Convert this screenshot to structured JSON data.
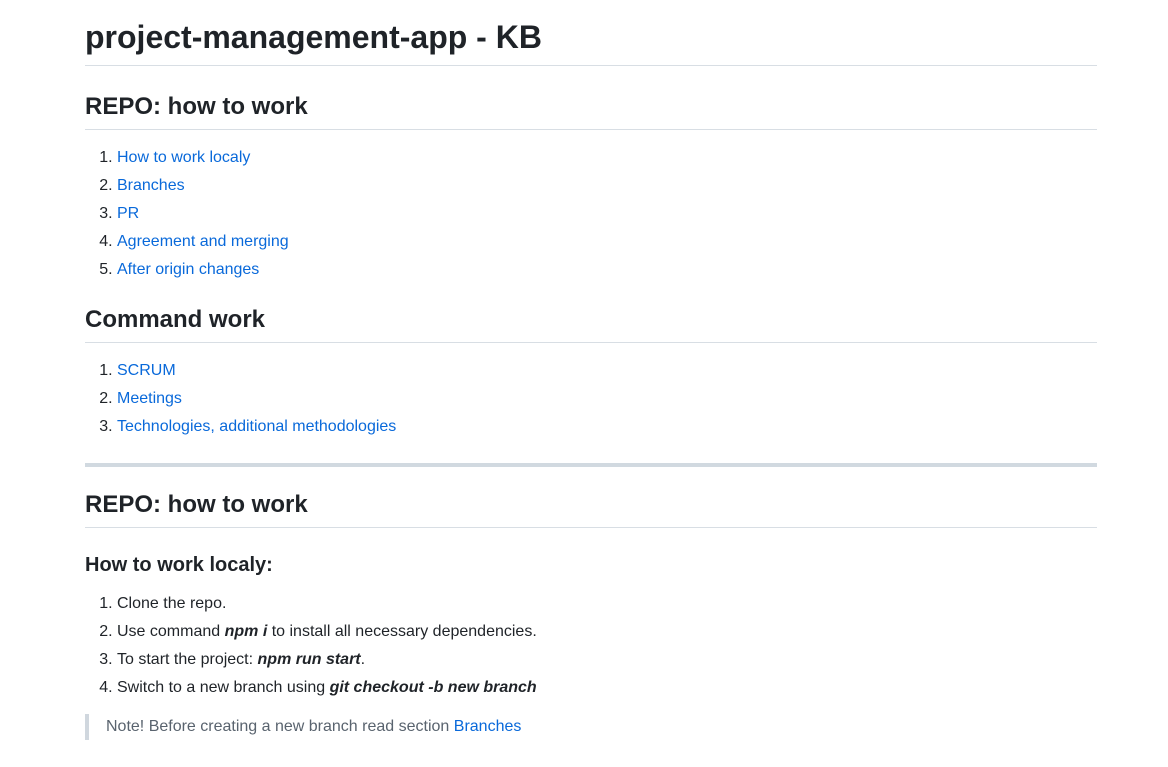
{
  "title": "project-management-app - KB",
  "toc": {
    "repo_heading": "REPO: how to work",
    "repo_items": [
      "How to work localy",
      "Branches",
      "PR",
      "Agreement and merging",
      "After origin changes"
    ],
    "command_heading": "Command work",
    "command_items": [
      "SCRUM",
      "Meetings",
      "Technologies, additional methodologies"
    ]
  },
  "section": {
    "heading": "REPO: how to work",
    "subheading": "How to work localy:",
    "steps": [
      {
        "before": "Clone the repo.",
        "cmd": "",
        "after": ""
      },
      {
        "before": "Use command ",
        "cmd": "npm i",
        "after": " to install all necessary dependencies."
      },
      {
        "before": "To start the project: ",
        "cmd": "npm run start",
        "after": "."
      },
      {
        "before": "Switch to a new branch using ",
        "cmd": "git checkout -b new branch",
        "after": ""
      }
    ],
    "note_text": "Note! Before creating a new branch read section ",
    "note_link": "Branches"
  },
  "colors": {
    "link": "#0969da",
    "text": "#1f2328",
    "muted": "#59636e",
    "rule": "#d1d9e0"
  }
}
